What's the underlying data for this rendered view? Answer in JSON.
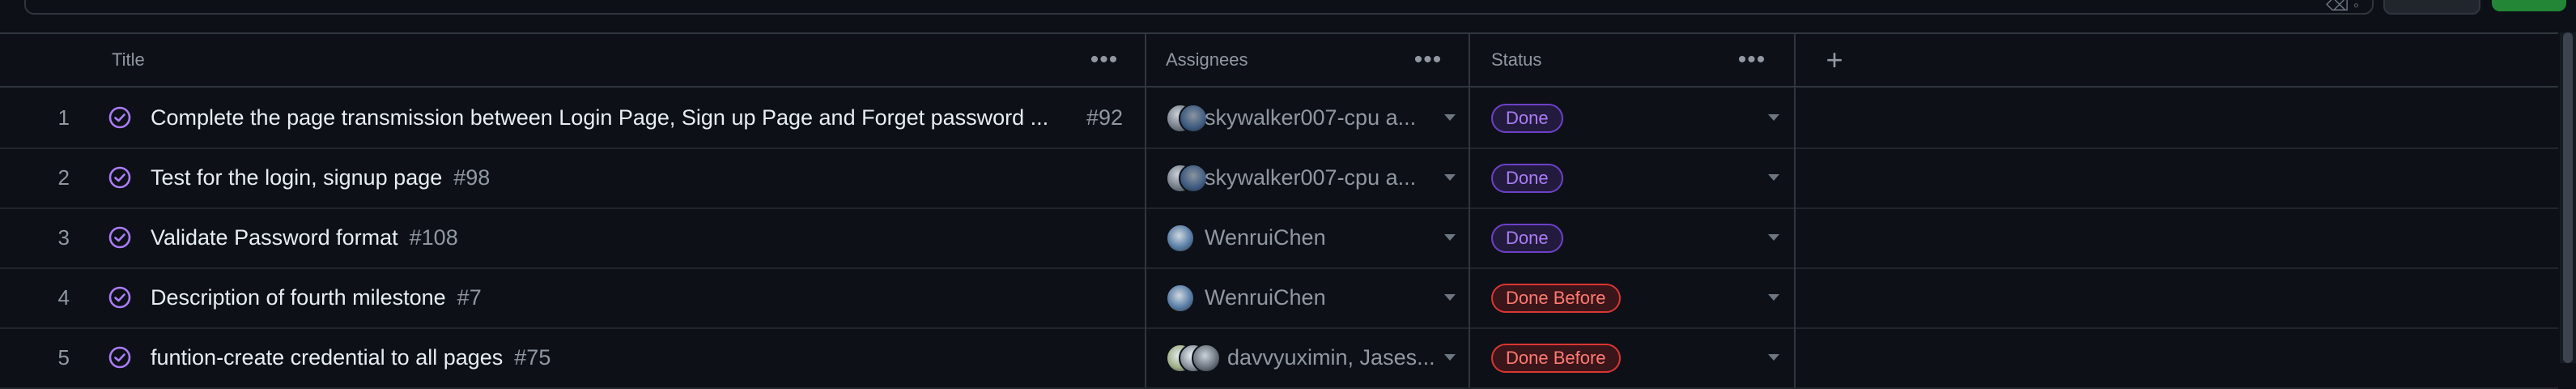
{
  "columns": [
    {
      "label": "Title",
      "menu": "•••"
    },
    {
      "label": "Assignees",
      "menu": "•••"
    },
    {
      "label": "Status",
      "menu": "•••"
    }
  ],
  "add_column_glyph": "+",
  "rows": [
    {
      "num": "1",
      "title": "Complete the page transmission between Login Page, Sign up Page and Forget password ...",
      "issue": "#92",
      "assignee": "skywalker007-cpu a...",
      "status": "Done"
    },
    {
      "num": "2",
      "title": "Test for the login, signup page",
      "issue": "#98",
      "assignee": "skywalker007-cpu a...",
      "status": "Done"
    },
    {
      "num": "3",
      "title": "Validate Password format",
      "issue": "#108",
      "assignee": "WenruiChen",
      "status": "Done"
    },
    {
      "num": "4",
      "title": "Description of fourth milestone",
      "issue": "#7",
      "assignee": "WenruiChen",
      "status": "Done Before"
    },
    {
      "num": "5",
      "title": "funtion-create credential to all pages",
      "issue": "#75",
      "assignee": "davvyuximin, Jases...",
      "status": "Done Before"
    }
  ],
  "colors": {
    "background": "#0d1117",
    "done": "#ab7df8",
    "done_before": "#ff7b72",
    "closed_icon": "#ab7df8"
  },
  "icons": [
    "issue-closed-icon",
    "avatar",
    "dropdown-caret-icon",
    "more-horizontal-icon",
    "plus-icon"
  ]
}
